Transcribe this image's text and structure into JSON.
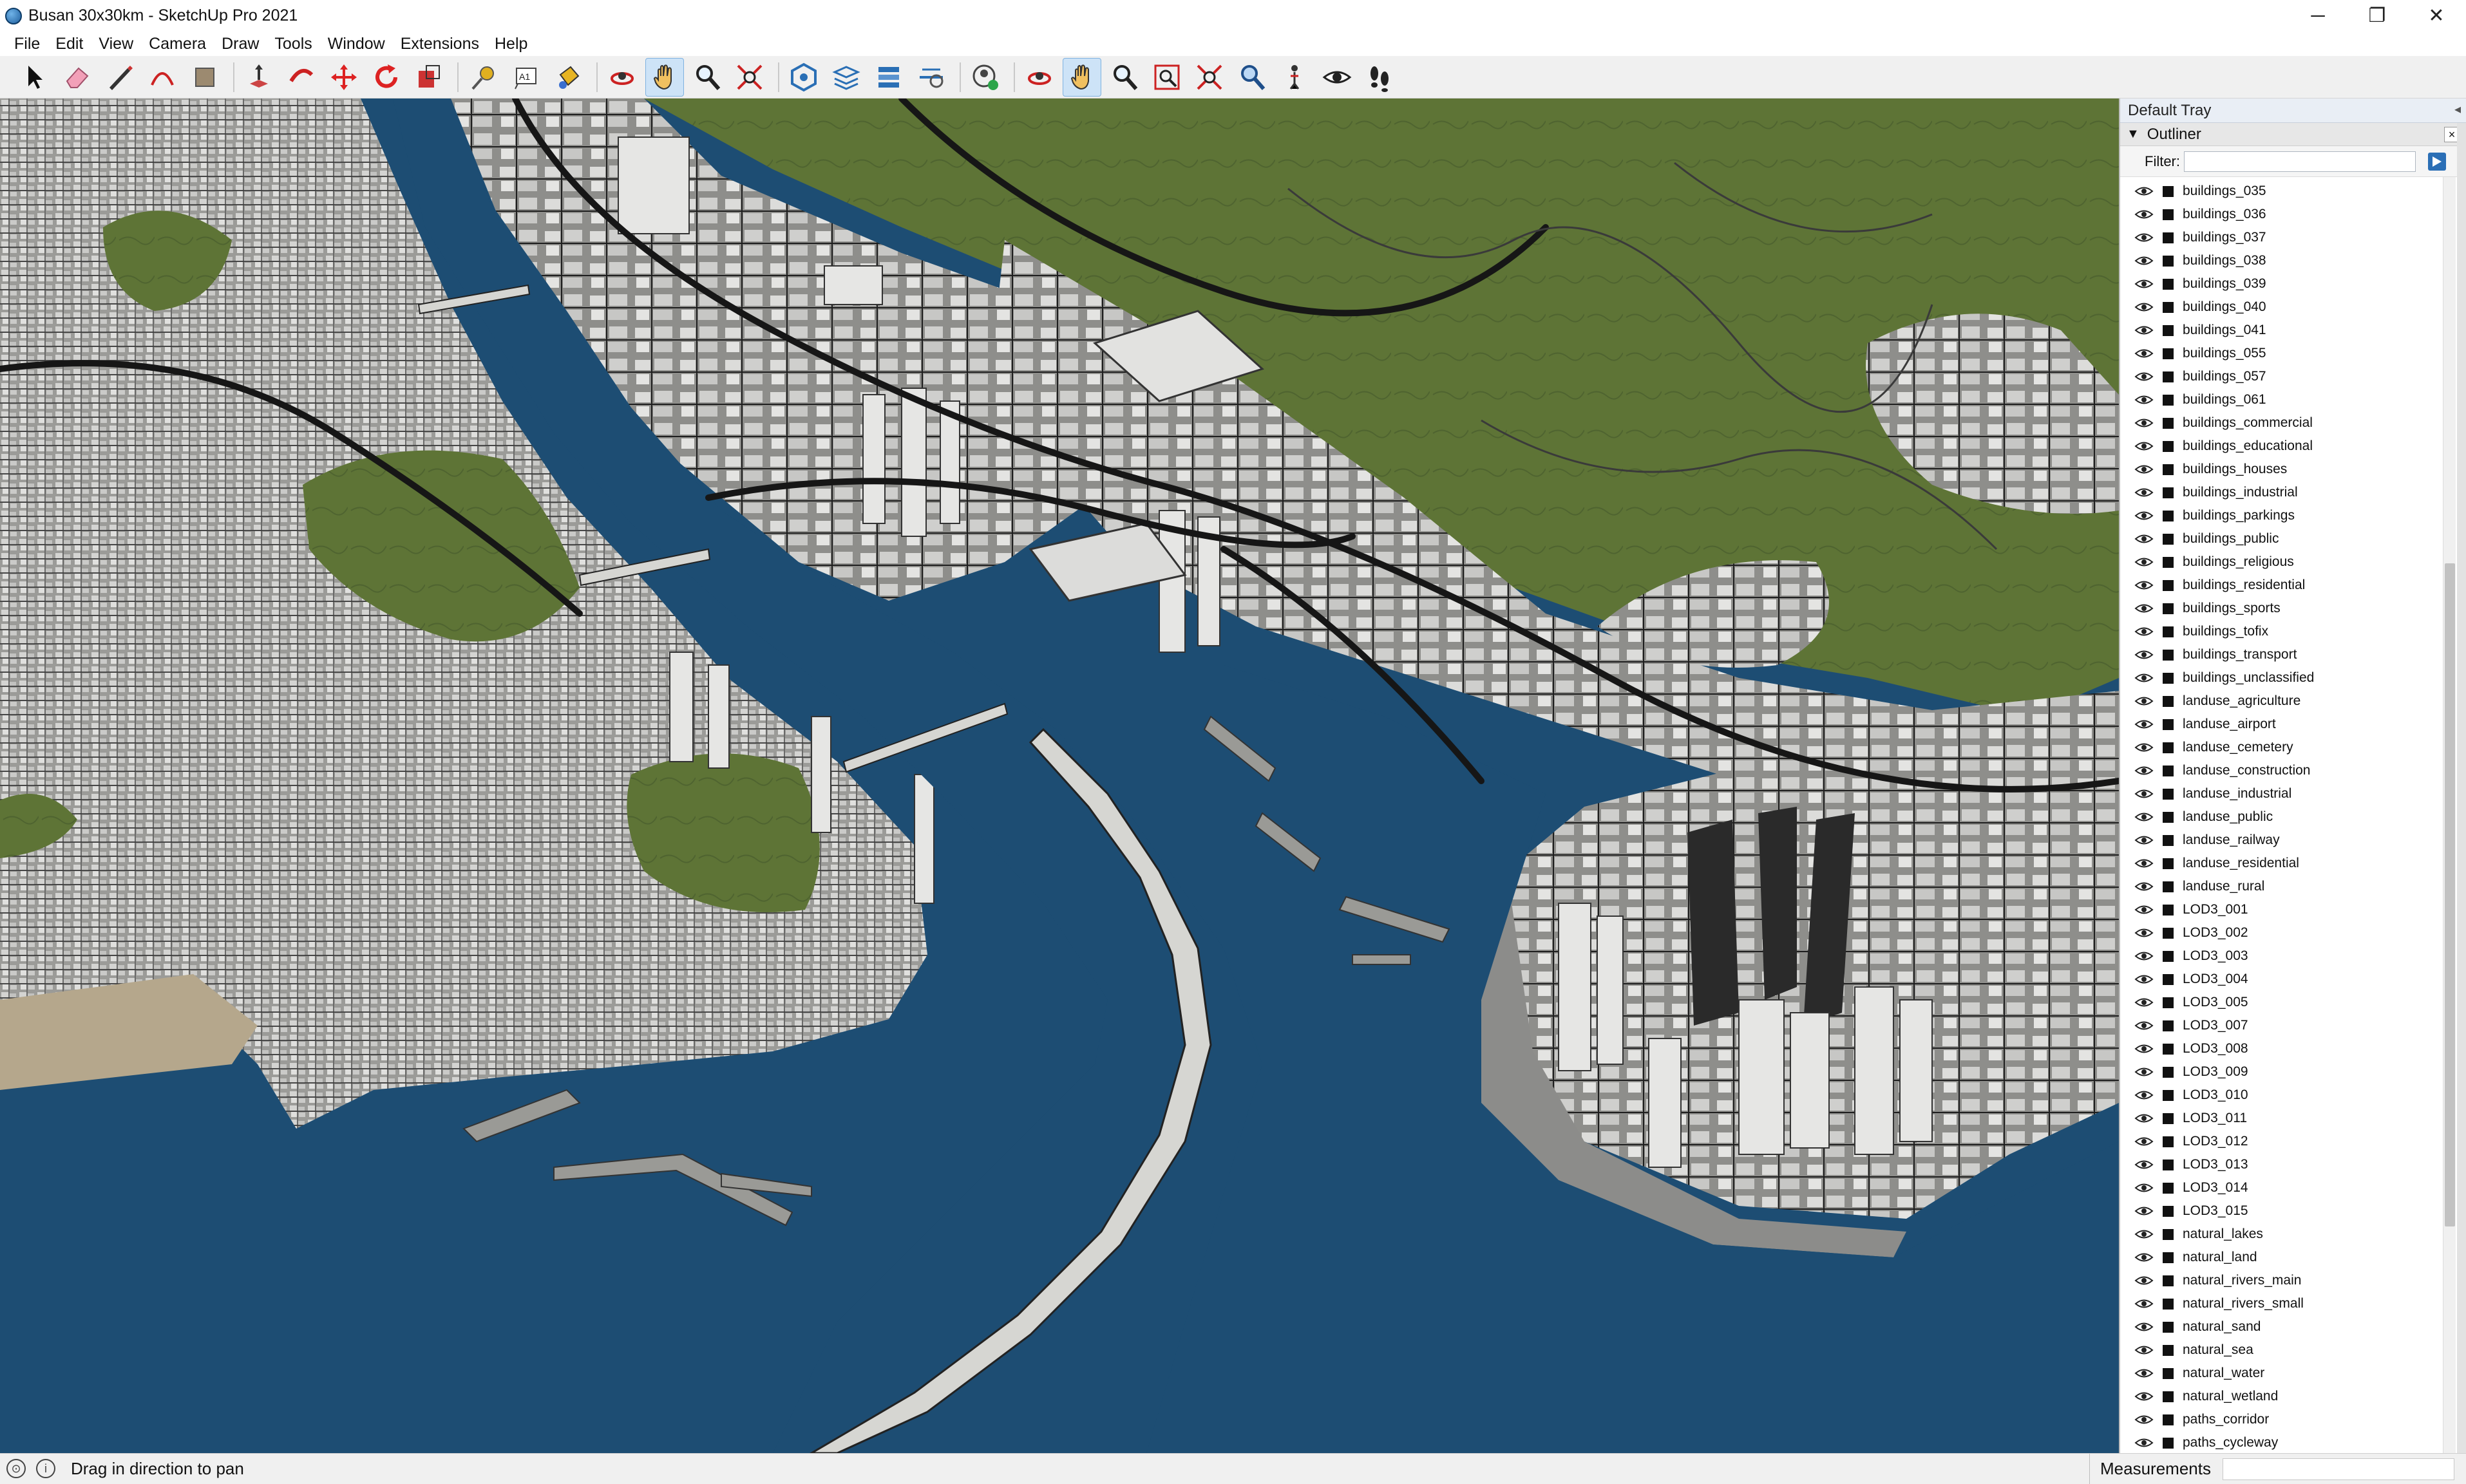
{
  "window": {
    "title": "Busan 30x30km - SketchUp Pro 2021",
    "minimize": "─",
    "maximize": "❐",
    "close": "✕"
  },
  "menu": [
    "File",
    "Edit",
    "View",
    "Camera",
    "Draw",
    "Tools",
    "Window",
    "Extensions",
    "Help"
  ],
  "toolbar": {
    "tools": [
      "select-tool",
      "eraser-tool",
      "line-tool",
      "arc-tool",
      "paint-bucket-tool",
      "push-pull-tool",
      "follow-me-tool",
      "move-tool",
      "rotate-tool",
      "scale-tool",
      "tape-measure-tool",
      "text-tool",
      "paint-tool",
      "orbit-tool",
      "pan-tool",
      "zoom-tool",
      "zoom-extents-tool",
      "sandbox-tool",
      "layers-tool",
      "section-tool",
      "styles-tool",
      "account-tool",
      "orbit-tool-2",
      "pan-tool-2",
      "zoom-tool-2",
      "zoom-window-tool",
      "zoom-extents-tool-2",
      "previous-view-tool",
      "position-camera-tool",
      "look-around-tool",
      "walk-tool"
    ],
    "active": "pan-tool",
    "text_tool_label": "A1"
  },
  "tray": {
    "title": "Default Tray",
    "outliner": {
      "title": "Outliner",
      "filter_label": "Filter:",
      "filter_value": "",
      "items": [
        "buildings_035",
        "buildings_036",
        "buildings_037",
        "buildings_038",
        "buildings_039",
        "buildings_040",
        "buildings_041",
        "buildings_055",
        "buildings_057",
        "buildings_061",
        "buildings_commercial",
        "buildings_educational",
        "buildings_houses",
        "buildings_industrial",
        "buildings_parkings",
        "buildings_public",
        "buildings_religious",
        "buildings_residential",
        "buildings_sports",
        "buildings_tofix",
        "buildings_transport",
        "buildings_unclassified",
        "landuse_agriculture",
        "landuse_airport",
        "landuse_cemetery",
        "landuse_construction",
        "landuse_industrial",
        "landuse_public",
        "landuse_railway",
        "landuse_residential",
        "landuse_rural",
        "LOD3_001",
        "LOD3_002",
        "LOD3_003",
        "LOD3_004",
        "LOD3_005",
        "LOD3_007",
        "LOD3_008",
        "LOD3_009",
        "LOD3_010",
        "LOD3_011",
        "LOD3_012",
        "LOD3_013",
        "LOD3_014",
        "LOD3_015",
        "natural_lakes",
        "natural_land",
        "natural_rivers_main",
        "natural_rivers_small",
        "natural_sand",
        "natural_sea",
        "natural_water",
        "natural_wetland",
        "paths_corridor",
        "paths_cycleway"
      ]
    }
  },
  "status": {
    "hint": "Drag in direction to pan",
    "measurements_label": "Measurements",
    "measurements_value": ""
  },
  "colors": {
    "water": "#1d4d73",
    "greenery": "#5e7436",
    "urban": "#8c8c8a",
    "building": "#d9d9d9",
    "road": "#1a1a1a",
    "active_tool": "#cde3f7"
  }
}
